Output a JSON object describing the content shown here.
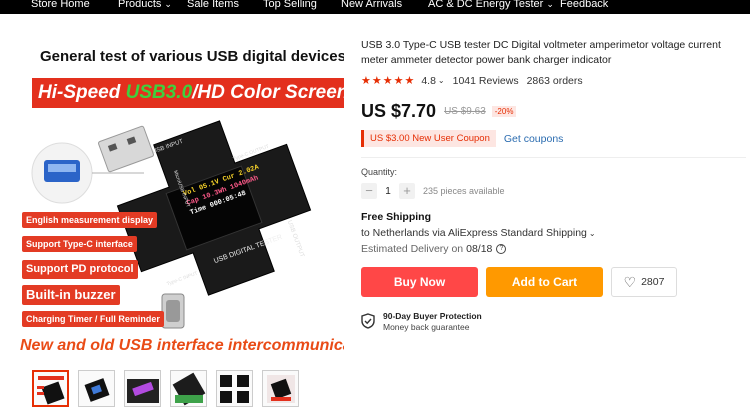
{
  "nav": {
    "items": [
      {
        "label": "Store Home",
        "caret": false
      },
      {
        "label": "Products",
        "caret": true
      },
      {
        "label": "Sale Items",
        "caret": false
      },
      {
        "label": "Top Selling",
        "caret": false
      },
      {
        "label": "New Arrivals",
        "caret": false
      },
      {
        "label": "AC & DC Energy Tester",
        "caret": true
      },
      {
        "label": "Feedback",
        "caret": false
      }
    ]
  },
  "image": {
    "title": "General test of various USB digital devices",
    "banner_prefix": "Hi-Speed ",
    "banner_green": "USB3.0",
    "banner_suffix": "/HD Color Screen",
    "features": [
      "English measurement display",
      "Support Type-C interface",
      "Support PD protocol",
      "Built-in buzzer",
      "Charging Timer / Full Reminder"
    ],
    "bottom_banner": "New and old USB interface intercommunication",
    "device_labels": {
      "usb_input": "USB INPUT",
      "usb_output": "USB OUTPUT",
      "micro_usb": "MicroUSB INPUT",
      "typec_input": "Type-C INPUT",
      "typec_output": "Type-C OUTPUT",
      "brand": "USB DIGITAL TESTER",
      "screen_line1": "Vol 05.1V Cur 2.02A",
      "screen_line2": "Cap 10.3Wh 1040mAh",
      "screen_line3": "Time 000:05:48"
    },
    "thumbnail_count": 6
  },
  "product": {
    "title": "USB 3.0 Type-C USB tester DC Digital voltmeter amperimetor voltage current meter ammeter detector power bank charger indicator",
    "stars": "★★★★★",
    "rating": "4.8",
    "reviews": "1041 Reviews",
    "orders": "2863 orders",
    "price": "US $7.70",
    "old_price": "US $9.63",
    "discount": "-20%",
    "coupon": "US $3.00 New User Coupon",
    "get_coupons": "Get coupons",
    "quantity_label": "Quantity:",
    "quantity": "1",
    "stock": "235 pieces available",
    "shipping_title": "Free Shipping",
    "shipping_via": "to Netherlands via AliExpress Standard Shipping",
    "delivery_label": "Estimated Delivery on",
    "delivery_date": "08/18",
    "buy_now": "Buy Now",
    "add_to_cart": "Add to Cart",
    "wishlist_count": "2807",
    "protection_title": "90-Day Buyer Protection",
    "protection_sub": "Money back guarantee"
  },
  "colors": {
    "nav_bg": "#000000",
    "accent_red": "#ff4747",
    "accent_orange": "#ff9900",
    "star": "#e62e04"
  }
}
